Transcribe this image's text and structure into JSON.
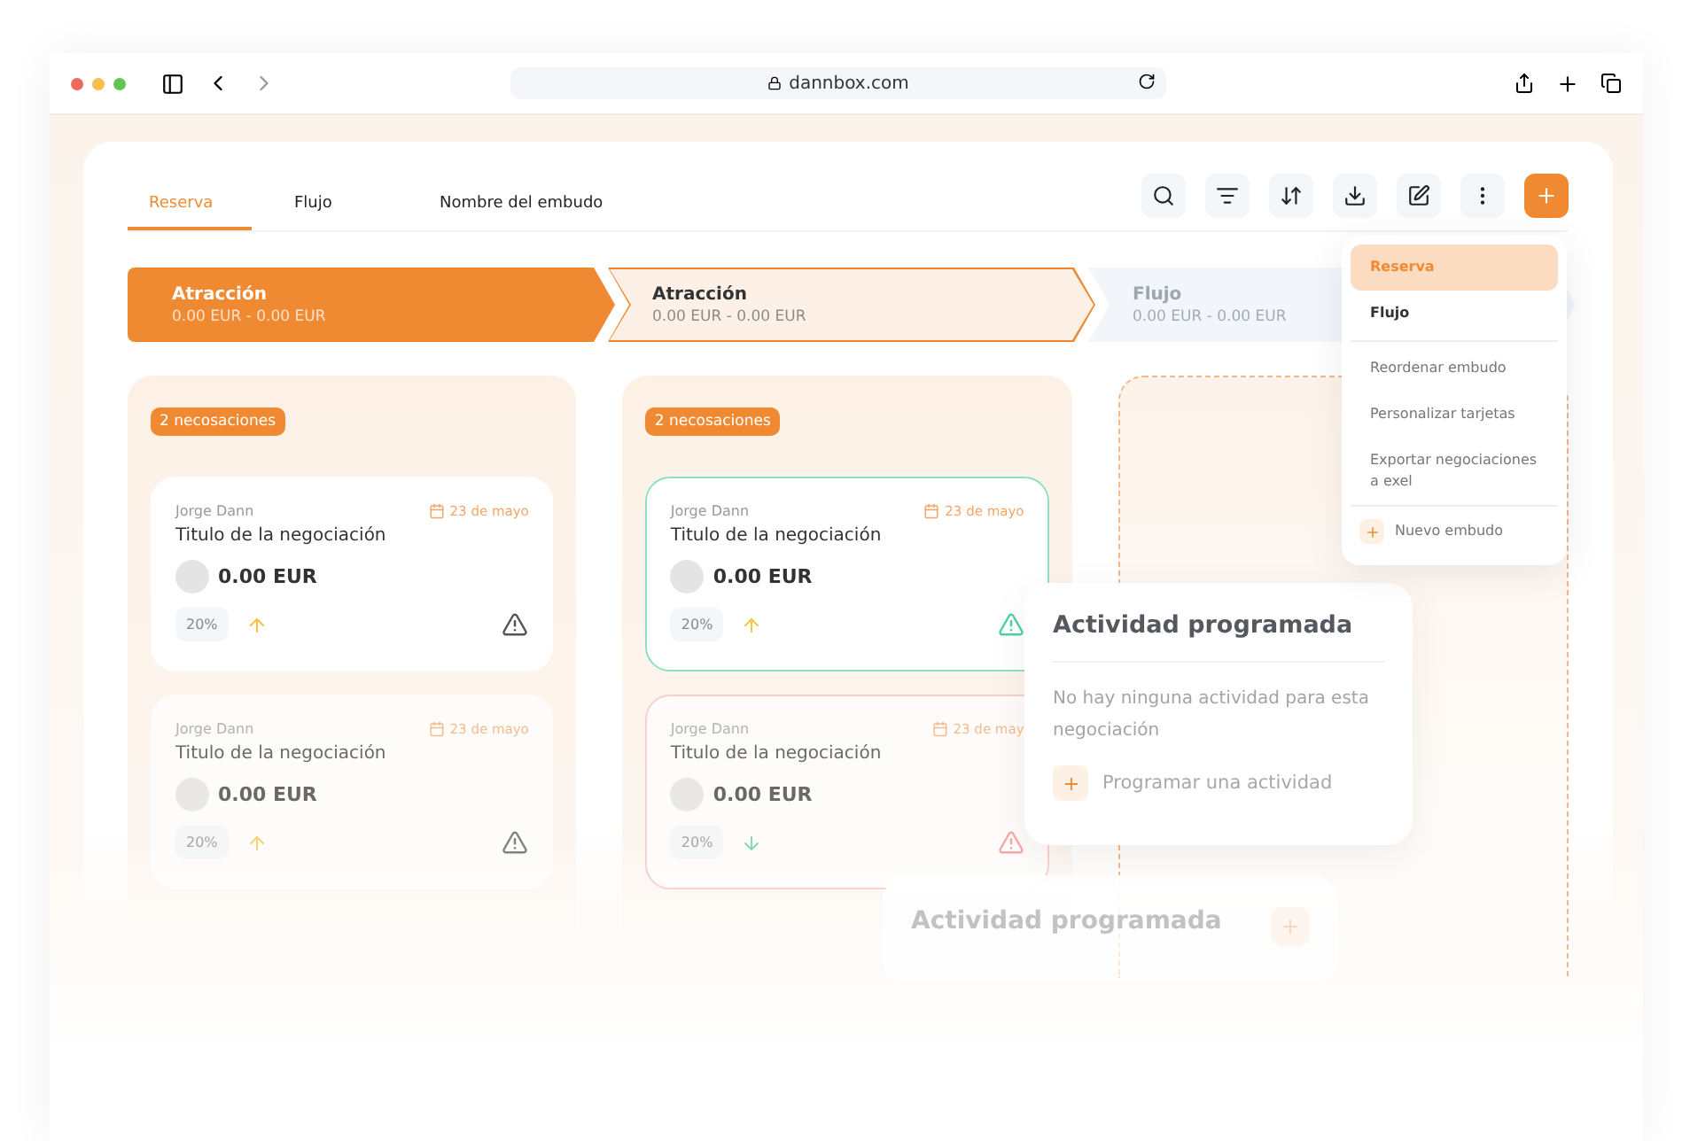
{
  "browser": {
    "url": "dannbox.com"
  },
  "tabs": [
    {
      "label": "Reserva",
      "selected": true
    },
    {
      "label": "Flujo",
      "selected": false
    },
    {
      "label": "Nombre del embudo",
      "selected": false
    }
  ],
  "stages": [
    {
      "title": "Atracción",
      "range": "0.00 EUR - 0.00 EUR",
      "kind": "active"
    },
    {
      "title": "Atracción",
      "range": "0.00 EUR - 0.00 EUR",
      "kind": "outline"
    },
    {
      "title": "Flujo",
      "range": "0.00 EUR - 0.00 EUR",
      "kind": "muted"
    }
  ],
  "columns": [
    {
      "kind": "list",
      "count": "2 necosaciones",
      "cards": [
        {
          "owner": "Jorge Dann",
          "date": "23 de mayo",
          "title": "Titulo de la negociación",
          "amount": "0.00 EUR",
          "percent": "20%",
          "rising": true,
          "kind": "normal",
          "faded": false
        },
        {
          "owner": "Jorge Dann",
          "date": "23 de mayo",
          "title": "Titulo de la negociación",
          "amount": "0.00 EUR",
          "percent": "20%",
          "rising": true,
          "kind": "normal",
          "faded": true
        }
      ]
    },
    {
      "kind": "list",
      "count": "2 necosaciones",
      "cards": [
        {
          "owner": "Jorge Dann",
          "date": "23 de mayo",
          "title": "Titulo de la negociación",
          "amount": "0.00 EUR",
          "percent": "20%",
          "rising": true,
          "kind": "success",
          "faded": false
        },
        {
          "owner": "Jorge Dann",
          "date": "23 de may",
          "title": "Titulo de la negociación",
          "amount": "0.00 EUR",
          "percent": "20%",
          "rising": false,
          "kind": "danger",
          "faded": true
        }
      ]
    },
    {
      "kind": "dropzone"
    }
  ],
  "menu": {
    "items": [
      {
        "label": "Reserva",
        "kind": "option",
        "selected": true
      },
      {
        "label": "Flujo",
        "kind": "option",
        "selected": false
      },
      {
        "label": "Reordenar embudo",
        "kind": "action",
        "selected": false
      },
      {
        "label": "Personalizar tarjetas",
        "kind": "action",
        "selected": false
      },
      {
        "label": "Exportar negociaciones a exel",
        "kind": "action",
        "selected": false
      },
      {
        "label": "Nuevo embudo",
        "kind": "add",
        "selected": false
      }
    ]
  },
  "activity_popup": {
    "title": "Actividad programada",
    "message": "No hay ninguna actividad para esta negociación",
    "action": "Programar una actividad"
  },
  "ghost_popup": {
    "title": "Actividad programada"
  }
}
